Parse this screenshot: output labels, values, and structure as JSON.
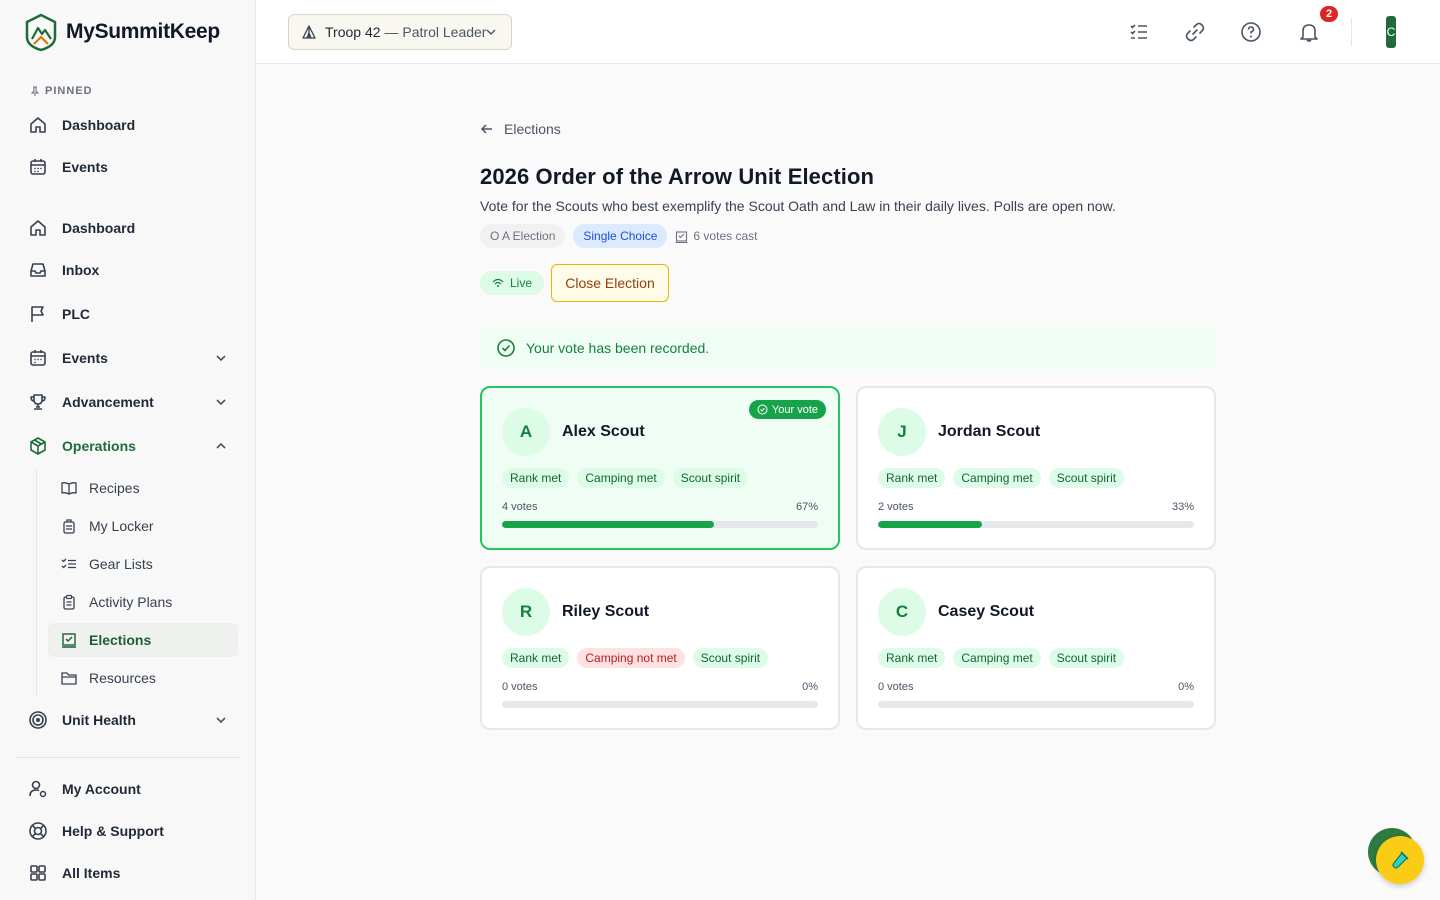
{
  "app": {
    "name": "MySummitKeep"
  },
  "sidebar": {
    "pinned_label": "PINNED",
    "pinned": [
      {
        "label": "Dashboard",
        "icon": "home-icon"
      },
      {
        "label": "Events",
        "icon": "calendar-icon"
      }
    ],
    "items": [
      {
        "label": "Dashboard",
        "icon": "home-icon"
      },
      {
        "label": "Inbox",
        "icon": "inbox-icon"
      },
      {
        "label": "PLC",
        "icon": "flag-icon"
      },
      {
        "label": "Events",
        "icon": "calendar-icon",
        "expandable": true
      },
      {
        "label": "Advancement",
        "icon": "trophy-icon",
        "expandable": true
      },
      {
        "label": "Operations",
        "icon": "box-icon",
        "expanded": true
      },
      {
        "label": "Unit Health",
        "icon": "target-icon",
        "expandable": true
      }
    ],
    "operations_sub": [
      {
        "label": "Recipes",
        "icon": "book-icon"
      },
      {
        "label": "My Locker",
        "icon": "locker-icon"
      },
      {
        "label": "Gear Lists",
        "icon": "checklist-icon"
      },
      {
        "label": "Activity Plans",
        "icon": "clipboard-icon"
      },
      {
        "label": "Elections",
        "icon": "ballot-icon",
        "active": true
      },
      {
        "label": "Resources",
        "icon": "folder-icon"
      }
    ],
    "footer": [
      {
        "label": "My Account",
        "icon": "user-gear-icon"
      },
      {
        "label": "Help & Support",
        "icon": "lifebuoy-icon"
      },
      {
        "label": "All Items",
        "icon": "grid-icon"
      }
    ]
  },
  "header": {
    "troop": "Troop 42",
    "role": "— Patrol Leader",
    "notification_count": "2",
    "avatar_letter": "C"
  },
  "page": {
    "back_label": "Elections",
    "title": "2026 Order of the Arrow Unit Election",
    "description": "Vote for the Scouts who best exemplify the Scout Oath and Law in their daily lives. Polls are open now.",
    "tags": [
      "O A Election",
      "Single Choice"
    ],
    "votes_cast": "6 votes cast",
    "status": "Live",
    "close_button": "Close Election",
    "alert": "Your vote has been recorded.",
    "your_vote_label": "Your vote"
  },
  "candidates": [
    {
      "initial": "A",
      "name": "Alex Scout",
      "tags": [
        {
          "t": "Rank met",
          "ok": true
        },
        {
          "t": "Camping met",
          "ok": true
        },
        {
          "t": "Scout spirit",
          "ok": true
        }
      ],
      "votes": "4 votes",
      "pct": "67%",
      "fraction": 0.67,
      "your_vote": true
    },
    {
      "initial": "J",
      "name": "Jordan Scout",
      "tags": [
        {
          "t": "Rank met",
          "ok": true
        },
        {
          "t": "Camping met",
          "ok": true
        },
        {
          "t": "Scout spirit",
          "ok": true
        }
      ],
      "votes": "2 votes",
      "pct": "33%",
      "fraction": 0.33,
      "your_vote": false
    },
    {
      "initial": "R",
      "name": "Riley Scout",
      "tags": [
        {
          "t": "Rank met",
          "ok": true
        },
        {
          "t": "Camping not met",
          "ok": false
        },
        {
          "t": "Scout spirit",
          "ok": true
        }
      ],
      "votes": "0 votes",
      "pct": "0%",
      "fraction": 0,
      "your_vote": false
    },
    {
      "initial": "C",
      "name": "Casey Scout",
      "tags": [
        {
          "t": "Rank met",
          "ok": true
        },
        {
          "t": "Camping met",
          "ok": true
        },
        {
          "t": "Scout spirit",
          "ok": true
        }
      ],
      "votes": "0 votes",
      "pct": "0%",
      "fraction": 0,
      "your_vote": false
    }
  ],
  "colors": {
    "brand": "#1f6b3a",
    "accent_green": "#16a34a",
    "warning": "#eab308",
    "danger": "#dc2626"
  }
}
